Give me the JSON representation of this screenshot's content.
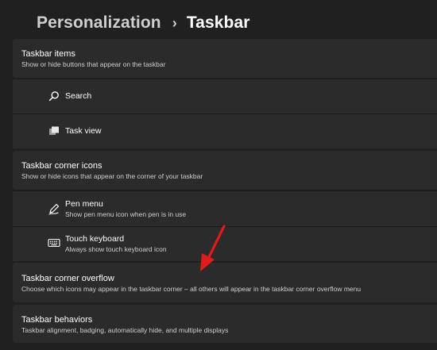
{
  "breadcrumb": {
    "parent": "Personalization",
    "separator": "›",
    "current": "Taskbar"
  },
  "taskbar_items": {
    "title": "Taskbar items",
    "subtitle": "Show or hide buttons that appear on the taskbar",
    "rows": [
      {
        "label": "Search",
        "icon": "search-icon"
      },
      {
        "label": "Task view",
        "icon": "task-view-icon"
      }
    ]
  },
  "corner_icons": {
    "title": "Taskbar corner icons",
    "subtitle": "Show or hide icons that appear on the corner of your taskbar",
    "rows": [
      {
        "label": "Pen menu",
        "sublabel": "Show pen menu icon when pen is in use",
        "icon": "pen-icon"
      },
      {
        "label": "Touch keyboard",
        "sublabel": "Always show touch keyboard icon",
        "icon": "keyboard-icon"
      }
    ]
  },
  "corner_overflow": {
    "title": "Taskbar corner overflow",
    "subtitle": "Choose which icons may appear in the taskbar corner – all others will appear in the taskbar corner overflow menu"
  },
  "behaviors": {
    "title": "Taskbar behaviors",
    "subtitle": "Taskbar alignment, badging, automatically hide, and multiple displays"
  },
  "colors": {
    "background": "#202020",
    "card": "#2b2b2b",
    "annotation_arrow": "#e01b1b"
  }
}
